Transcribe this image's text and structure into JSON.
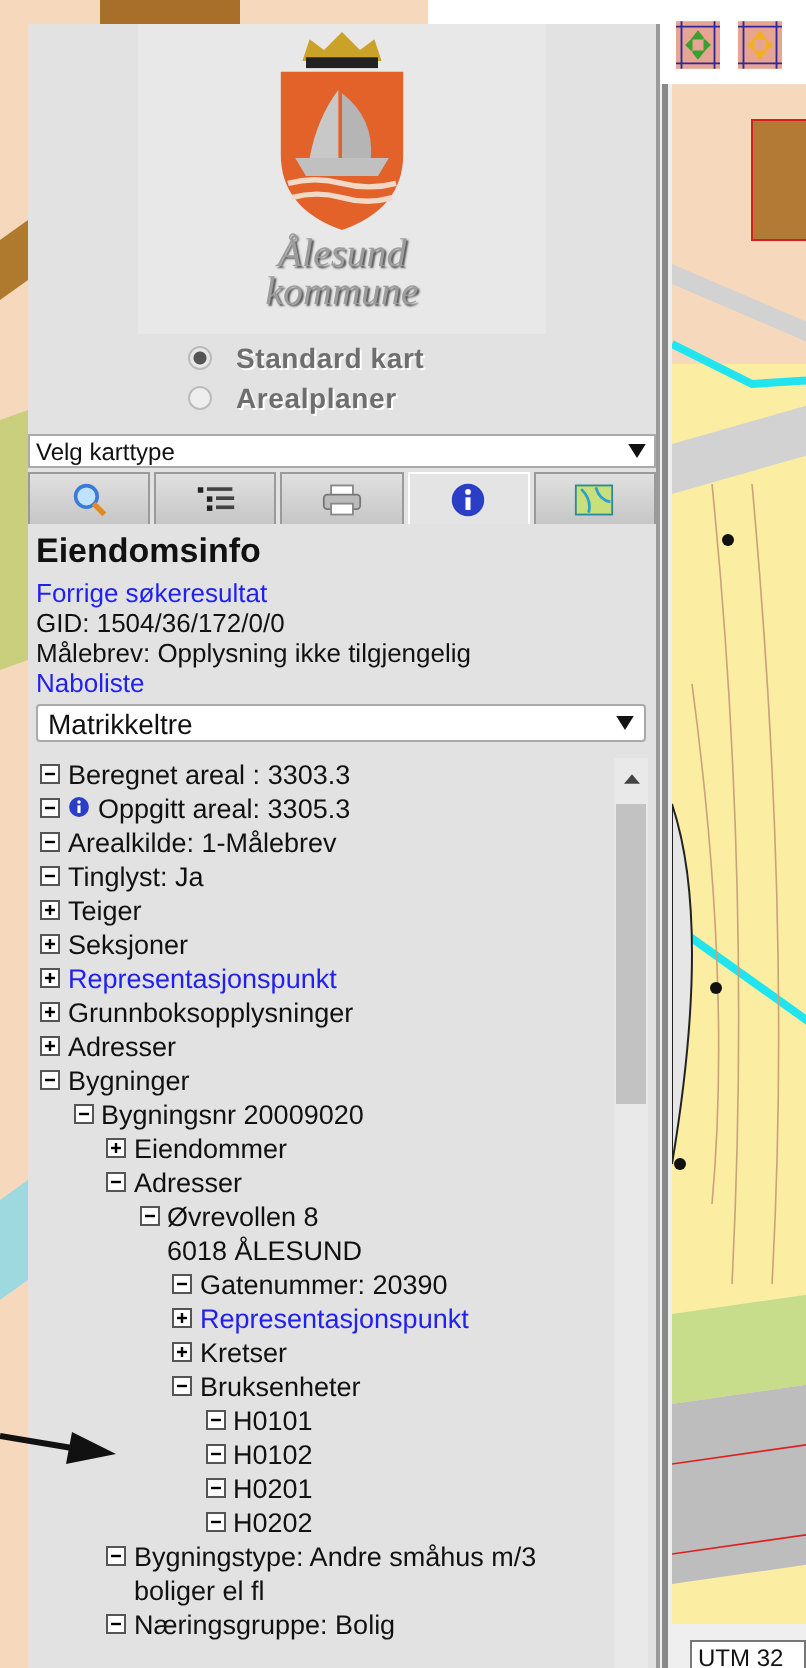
{
  "logo": {
    "name_lines": [
      "Ålesund",
      "kommune"
    ]
  },
  "map_type": {
    "options": [
      {
        "label": "Standard kart",
        "selected": true
      },
      {
        "label": "Arealplaner",
        "selected": false
      }
    ],
    "select": "Velg karttype"
  },
  "tabs": [
    {
      "kind": "search",
      "selected": false
    },
    {
      "kind": "legend",
      "selected": false
    },
    {
      "kind": "print",
      "selected": false
    },
    {
      "kind": "info",
      "selected": true
    },
    {
      "kind": "map",
      "selected": false
    }
  ],
  "info": {
    "title": "Eiendomsinfo",
    "lines": [
      {
        "kind": "link",
        "text": "Forrige søkeresultat"
      },
      {
        "kind": "text",
        "text": "GID: 1504/36/172/0/0"
      },
      {
        "kind": "text",
        "text": "Målebrev: Opplysning ikke tilgjengelig"
      },
      {
        "kind": "link",
        "text": "Naboliste"
      }
    ],
    "view_select": "Matrikkeltre"
  },
  "tree": [
    {
      "lines": [
        "Beregnet areal : 3303.3"
      ],
      "expanded": true
    },
    {
      "lines": [
        "Oppgitt areal: 3305.3"
      ],
      "expanded": true,
      "info": true
    },
    {
      "lines": [
        "Arealkilde: 1-Målebrev"
      ],
      "expanded": true
    },
    {
      "lines": [
        "Tinglyst: Ja"
      ],
      "expanded": true
    },
    {
      "lines": [
        "Teiger"
      ],
      "expanded": false
    },
    {
      "lines": [
        "Seksjoner"
      ],
      "expanded": false
    },
    {
      "lines": [
        "Representasjonspunkt"
      ],
      "expanded": false,
      "link": true
    },
    {
      "lines": [
        "Grunnboksopplysninger"
      ],
      "expanded": false
    },
    {
      "lines": [
        "Adresser"
      ],
      "expanded": false
    },
    {
      "lines": [
        "Bygninger"
      ],
      "expanded": true,
      "children": [
        {
          "lines": [
            "Bygningsnr 20009020"
          ],
          "expanded": true,
          "children": [
            {
              "lines": [
                "Eiendommer"
              ],
              "expanded": false
            },
            {
              "lines": [
                "Adresser"
              ],
              "expanded": true,
              "children": [
                {
                  "lines": [
                    "Øvrevollen 8",
                    "6018 ÅLESUND"
                  ],
                  "expanded": true,
                  "children": [
                    {
                      "lines": [
                        "Gatenummer: 20390"
                      ],
                      "expanded": true
                    },
                    {
                      "lines": [
                        "Representasjonspunkt"
                      ],
                      "expanded": false,
                      "link": true
                    },
                    {
                      "lines": [
                        "Kretser"
                      ],
                      "expanded": false
                    },
                    {
                      "lines": [
                        "Bruksenheter"
                      ],
                      "expanded": true,
                      "children": [
                        {
                          "lines": [
                            "H0101"
                          ],
                          "expanded": true
                        },
                        {
                          "lines": [
                            "H0102"
                          ],
                          "expanded": true
                        },
                        {
                          "lines": [
                            "H0201"
                          ],
                          "expanded": true
                        },
                        {
                          "lines": [
                            "H0202"
                          ],
                          "expanded": true
                        }
                      ]
                    }
                  ]
                }
              ]
            },
            {
              "lines": [
                "Bygningstype: Andre småhus m/3 boliger el fl"
              ],
              "expanded": true
            },
            {
              "lines": [
                "Næringsgruppe: Bolig"
              ],
              "expanded": true
            }
          ]
        }
      ]
    }
  ],
  "map": {
    "coordinate_field": "UTM 32"
  }
}
